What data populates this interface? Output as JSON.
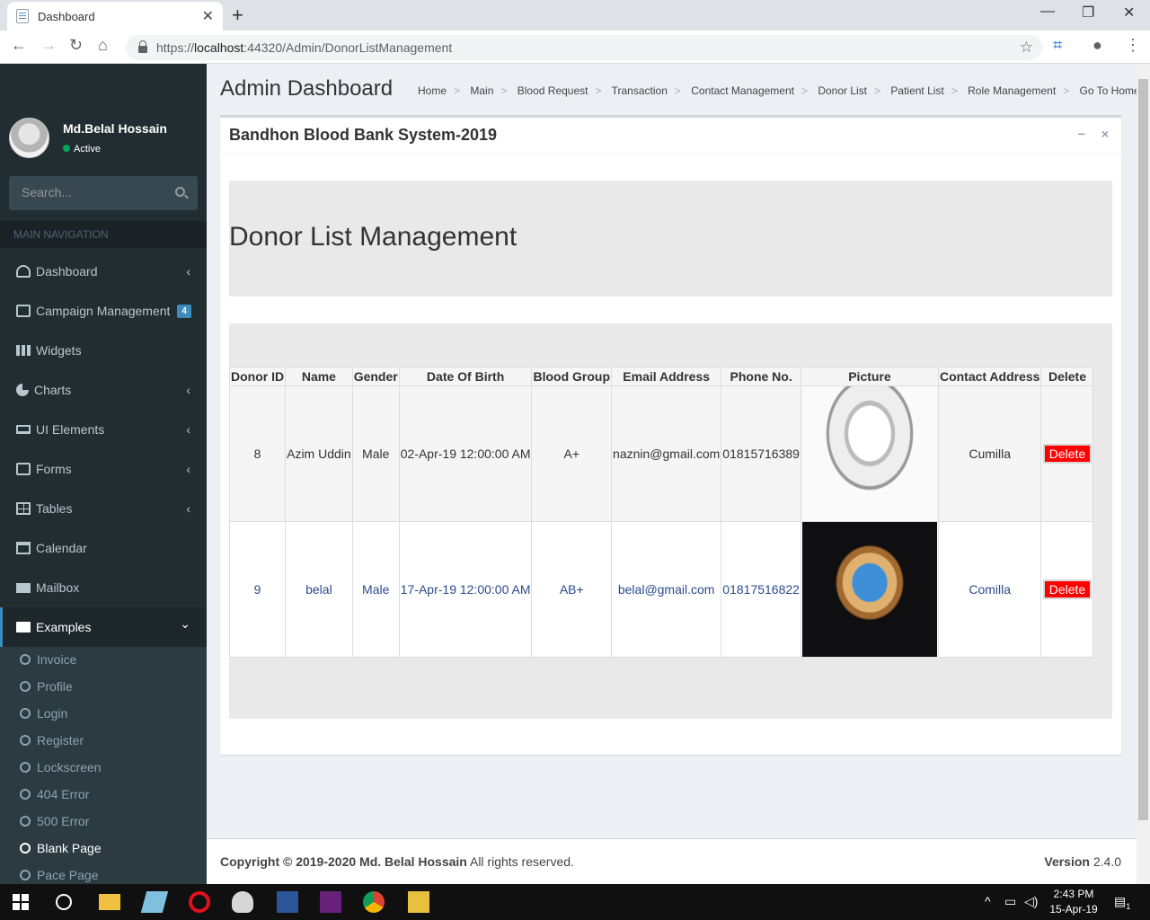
{
  "browser": {
    "tab_title": "Dashboard",
    "tab_close": "✕",
    "new_tab": "+",
    "url_prefix": "https://",
    "url_host": "localhost",
    "url_rest": ":44320/Admin/DonorListManagement",
    "window_controls": [
      "—",
      "❐",
      "✕"
    ]
  },
  "sidebar": {
    "user_name": "Md.Belal Hossain",
    "user_status": "Active",
    "search_placeholder": "Search...",
    "section_header": "MAIN NAVIGATION",
    "items": [
      {
        "label": "Dashboard",
        "icon": "dashboard-icon",
        "caret": "‹"
      },
      {
        "label": "Campaign Management",
        "icon": "files-icon",
        "badge": "4"
      },
      {
        "label": "Widgets",
        "icon": "th-icon"
      },
      {
        "label": "Charts",
        "icon": "pie-chart-icon",
        "caret": "‹"
      },
      {
        "label": "UI Elements",
        "icon": "laptop-icon",
        "caret": "‹"
      },
      {
        "label": "Forms",
        "icon": "edit-icon",
        "caret": "‹"
      },
      {
        "label": "Tables",
        "icon": "table-icon",
        "caret": "‹"
      },
      {
        "label": "Calendar",
        "icon": "calendar-icon"
      },
      {
        "label": "Mailbox",
        "icon": "envelope-icon"
      },
      {
        "label": "Examples",
        "icon": "folder-icon",
        "caret": "⌄"
      }
    ],
    "subitems": [
      "Invoice",
      "Profile",
      "Login",
      "Register",
      "Lockscreen",
      "404 Error",
      "500 Error",
      "Blank Page",
      "Pace Page"
    ]
  },
  "header": {
    "title": "Admin Dashboard",
    "breadcrumb": [
      "Home",
      "Main",
      "Blood Request",
      "Transaction",
      "Contact Management",
      "Donor List",
      "Patient List",
      "Role Management",
      "Go To Home"
    ],
    "separator": ">"
  },
  "box": {
    "title": "Bandhon Blood Bank System-2019",
    "minimize": "−",
    "close": "×",
    "heading": "Donor List Management"
  },
  "table": {
    "columns": [
      "Donor ID",
      "Name",
      "Gender",
      "Date Of Birth",
      "Blood Group",
      "Email Address",
      "Phone No.",
      "Picture",
      "Contact Address",
      "Delete"
    ],
    "rows": [
      {
        "id": "8",
        "name": "Azim Uddin",
        "gender": "Male",
        "dob": "02-Apr-19 12:00:00 AM",
        "blood": "A+",
        "email": "naznin@gmail.com",
        "phone": "01815716389",
        "address": "Cumilla",
        "delete": "Delete"
      },
      {
        "id": "9",
        "name": "belal",
        "gender": "Male",
        "dob": "17-Apr-19 12:00:00 AM",
        "blood": "AB+",
        "email": "belal@gmail.com",
        "phone": "01817516822",
        "address": "Comilla",
        "delete": "Delete"
      }
    ]
  },
  "footer": {
    "copyright_bold": "Copyright © 2019-2020 Md. Belal Hossain",
    "copyright_rest": " All rights reserved.",
    "version_label": "Version",
    "version_value": " 2.4.0"
  },
  "taskbar": {
    "time": "2:43 PM",
    "date": "15-Apr-19",
    "notification_count": "1"
  },
  "colors": {
    "sidebar_bg": "#222d32",
    "accent": "#3c8dbc",
    "delete_button": "#ff0000",
    "status_online": "#00a65a"
  }
}
